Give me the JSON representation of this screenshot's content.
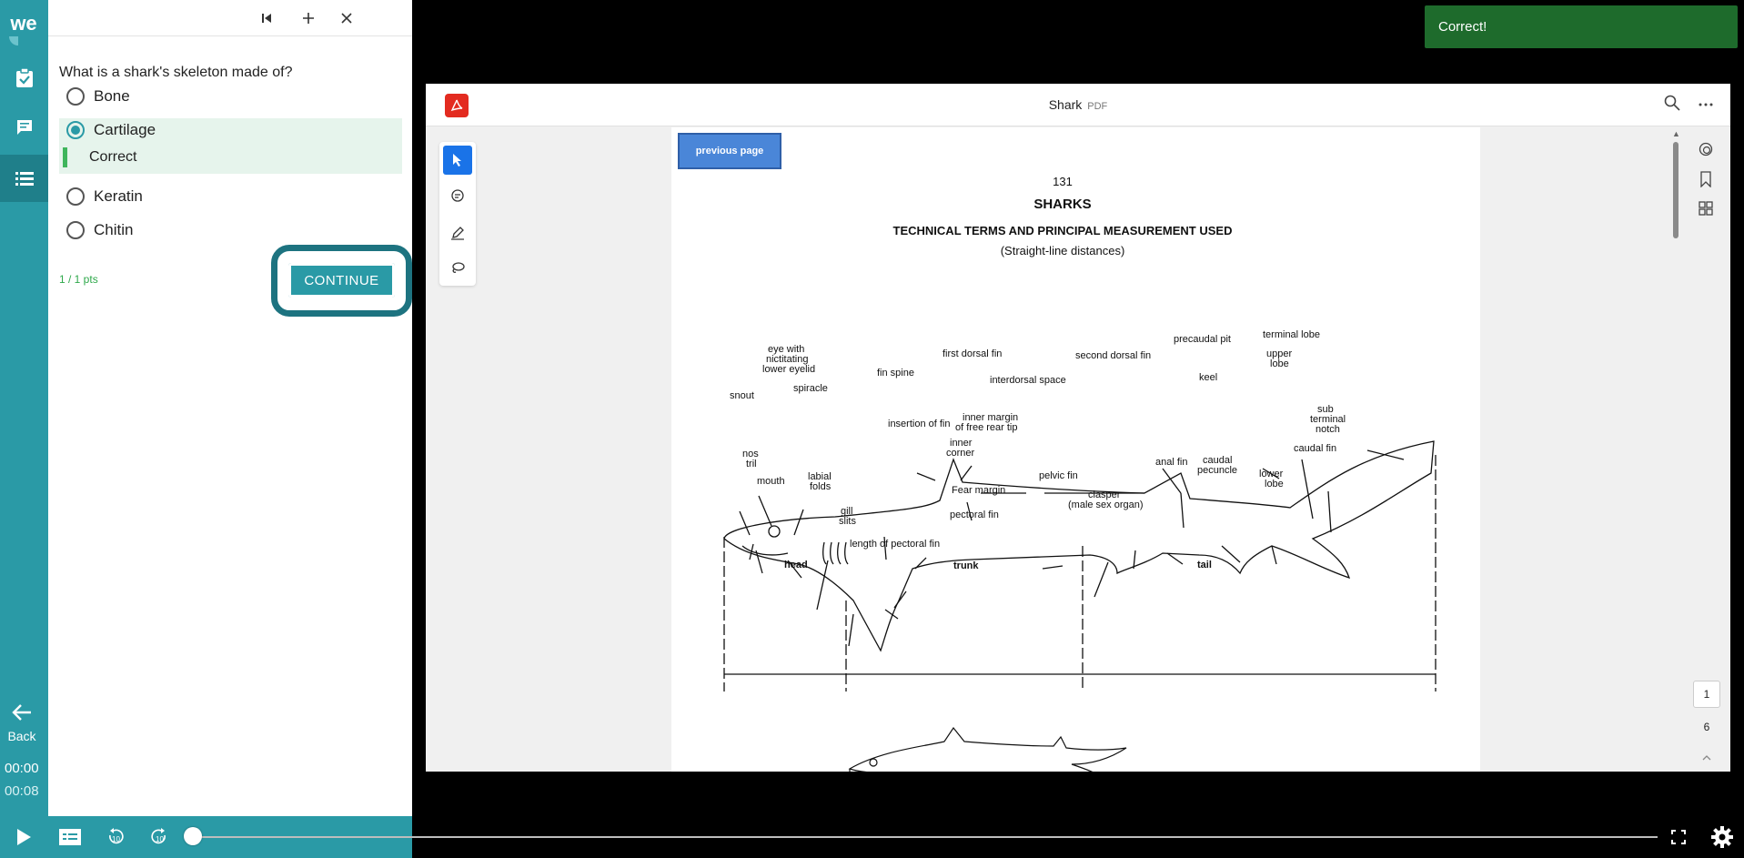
{
  "rail": {
    "logo": "we",
    "back_label": "Back",
    "elapsed": "00:00",
    "duration": "00:08"
  },
  "quiz": {
    "question": "What is a shark's skeleton made of?",
    "options": [
      {
        "label": "Bone",
        "selected": false
      },
      {
        "label": "Cartilage",
        "selected": true
      },
      {
        "label": "Keratin",
        "selected": false
      },
      {
        "label": "Chitin",
        "selected": false
      }
    ],
    "feedback": "Correct",
    "points": "1 / 1 pts",
    "continue_label": "CONTINUE"
  },
  "toast": {
    "message": "Correct!"
  },
  "viewer": {
    "title": "Shark",
    "type_tag": "PDF",
    "current_page": "1",
    "total_pages": "6",
    "page": {
      "prev_button": "previous page",
      "page_number": "131",
      "heading": "SHARKS",
      "subheading": "TECHNICAL TERMS AND PRINCIPAL MEASUREMENT USED",
      "note": "(Straight-line distances)",
      "diagram_labels": {
        "eye": [
          "eye with",
          "nictitating",
          "lower eyelid"
        ],
        "snout": "snout",
        "spiracle": "spiracle",
        "fin_spine": "fin spine",
        "first_dorsal": "first dorsal fin",
        "second_dorsal": "second dorsal fin",
        "interdorsal": "interdorsal space",
        "precaudal_pit": "precaudal pit",
        "terminal_lobe": "terminal lobe",
        "upper_lobe": [
          "upper",
          "lobe"
        ],
        "keel": "keel",
        "sub_terminal": [
          "sub",
          "terminal",
          "notch"
        ],
        "inner_margin": [
          "inner margin",
          "of free rear tip"
        ],
        "insertion": "insertion of fin",
        "inner_corner": [
          "inner",
          "corner"
        ],
        "nostril": [
          "nos",
          "tril"
        ],
        "mouth": "mouth",
        "labial": [
          "labial",
          "folds"
        ],
        "fear_margin": "Fear margin",
        "pelvic_fin": "pelvic fin",
        "anal_fin": "anal fin",
        "caudal_peduncle": [
          "caudal",
          "pecuncle"
        ],
        "caudal_fin": "caudal fin",
        "lower_lobe": [
          "lower",
          "lobe"
        ],
        "clasper": [
          "clasper",
          "(male sex organ)"
        ],
        "pectoral_fin": "pectoral fin",
        "gill_slits": [
          "gill",
          "slits"
        ],
        "length_pectoral": "length of pectoral fin",
        "head": "head",
        "trunk": "trunk",
        "tail": "tail"
      }
    }
  },
  "icons": {
    "first": "skip-first-icon",
    "add": "plus-icon",
    "close": "close-icon"
  },
  "colors": {
    "teal": "#2a9aa6",
    "teal_dark": "#1d7380",
    "success": "#1e6b2c",
    "pdf_red": "#e32b20",
    "tool_blue": "#1a73e8"
  }
}
